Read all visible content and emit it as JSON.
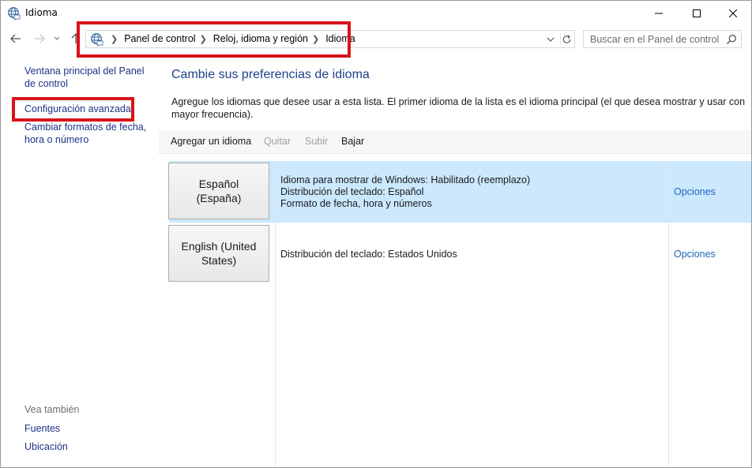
{
  "window": {
    "title": "Idioma"
  },
  "address_bar": {
    "crumbs": [
      "Panel de control",
      "Reloj, idioma y región",
      "Idioma"
    ]
  },
  "search": {
    "placeholder": "Buscar en el Panel de control"
  },
  "sidebar": {
    "home_link": "Ventana principal del Panel de control",
    "advanced_link": "Configuración avanzada",
    "formats_link": "Cambiar formatos de fecha, hora o número",
    "see_also_label": "Vea también",
    "see_also_items": [
      "Fuentes",
      "Ubicación"
    ]
  },
  "main": {
    "heading": "Cambie sus preferencias de idioma",
    "description": "Agregue los idiomas que desee usar a esta lista. El primer idioma de la lista es el idioma principal (el que desea mostrar y usar con mayor frecuencia).",
    "toolbar": {
      "add_label": "Agregar un idioma",
      "remove_label": "Quitar",
      "up_label": "Subir",
      "down_label": "Bajar"
    },
    "languages": [
      {
        "name": "Español (España)",
        "details": [
          "Idioma para mostrar de Windows: Habilitado (reemplazo)",
          "Distribución del teclado: Español",
          "Formato de fecha, hora y números"
        ],
        "options_label": "Opciones",
        "selected": true
      },
      {
        "name": "English (United States)",
        "details": [
          "Distribución del teclado: Estados Unidos"
        ],
        "options_label": "Opciones",
        "selected": false
      }
    ]
  },
  "icons": {
    "title": "language-globe-icon",
    "back": "arrow-left-icon",
    "forward": "arrow-right-icon",
    "recent": "chevron-down-icon",
    "up": "arrow-up-icon",
    "dropdown": "chevron-down-icon",
    "refresh": "refresh-icon",
    "search": "search-icon"
  },
  "colors": {
    "annotation_red": "#d7141b",
    "selection_blue": "#cce8ff",
    "link_blue": "#1e3287",
    "heading_blue": "#1e3f8a"
  }
}
